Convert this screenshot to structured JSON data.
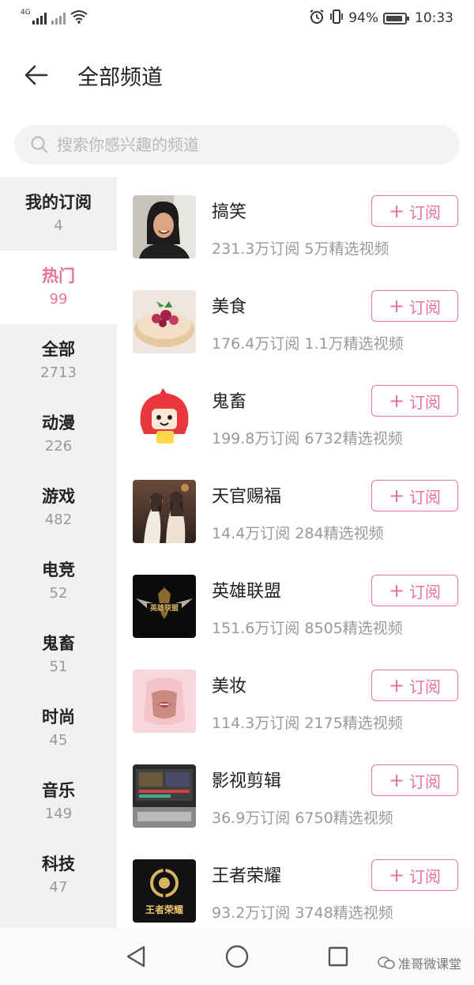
{
  "status_bar": {
    "network_label": "4G",
    "battery_text": "94%",
    "time": "10:33",
    "icons": [
      "signal-icon",
      "signal-weak-icon",
      "wifi-icon",
      "alarm-icon",
      "vibrate-icon",
      "battery-icon"
    ]
  },
  "header": {
    "title": "全部频道",
    "back_icon": "arrow-left-icon"
  },
  "search": {
    "placeholder": "搜索你感兴趣的频道",
    "icon": "search-icon"
  },
  "sidebar": {
    "items": [
      {
        "label": "我的订阅",
        "count": "4",
        "active": false
      },
      {
        "label": "热门",
        "count": "99",
        "active": true
      },
      {
        "label": "全部",
        "count": "2713",
        "active": false
      },
      {
        "label": "动漫",
        "count": "226",
        "active": false
      },
      {
        "label": "游戏",
        "count": "482",
        "active": false
      },
      {
        "label": "电竞",
        "count": "52",
        "active": false
      },
      {
        "label": "鬼畜",
        "count": "51",
        "active": false
      },
      {
        "label": "时尚",
        "count": "45",
        "active": false
      },
      {
        "label": "音乐",
        "count": "149",
        "active": false
      },
      {
        "label": "科技",
        "count": "47",
        "active": false
      }
    ]
  },
  "subscribe_label": "订阅",
  "subscribe_plus": "+",
  "channels": [
    {
      "name": "搞笑",
      "stats": "231.3万订阅  5万精选视频"
    },
    {
      "name": "美食",
      "stats": "176.4万订阅  1.1万精选视频"
    },
    {
      "name": "鬼畜",
      "stats": "199.8万订阅  6732精选视频"
    },
    {
      "name": "天官赐福",
      "stats": "14.4万订阅  284精选视频"
    },
    {
      "name": "英雄联盟",
      "stats": "151.6万订阅  8505精选视频"
    },
    {
      "name": "美妆",
      "stats": "114.3万订阅  2175精选视频"
    },
    {
      "name": "影视剪辑",
      "stats": "36.9万订阅  6750精选视频"
    },
    {
      "name": "王者荣耀",
      "stats": "93.2万订阅  3748精选视频"
    }
  ],
  "thumb_text": {
    "lol": "英雄联盟",
    "wzry": "王者荣耀"
  },
  "nav": {
    "icons": [
      "back-triangle-icon",
      "home-circle-icon",
      "recents-square-icon"
    ]
  },
  "watermark": "准哥微课堂",
  "colors": {
    "accent": "#e8739a",
    "sidebar_bg": "#f1f1f1",
    "muted_text": "#999999"
  }
}
